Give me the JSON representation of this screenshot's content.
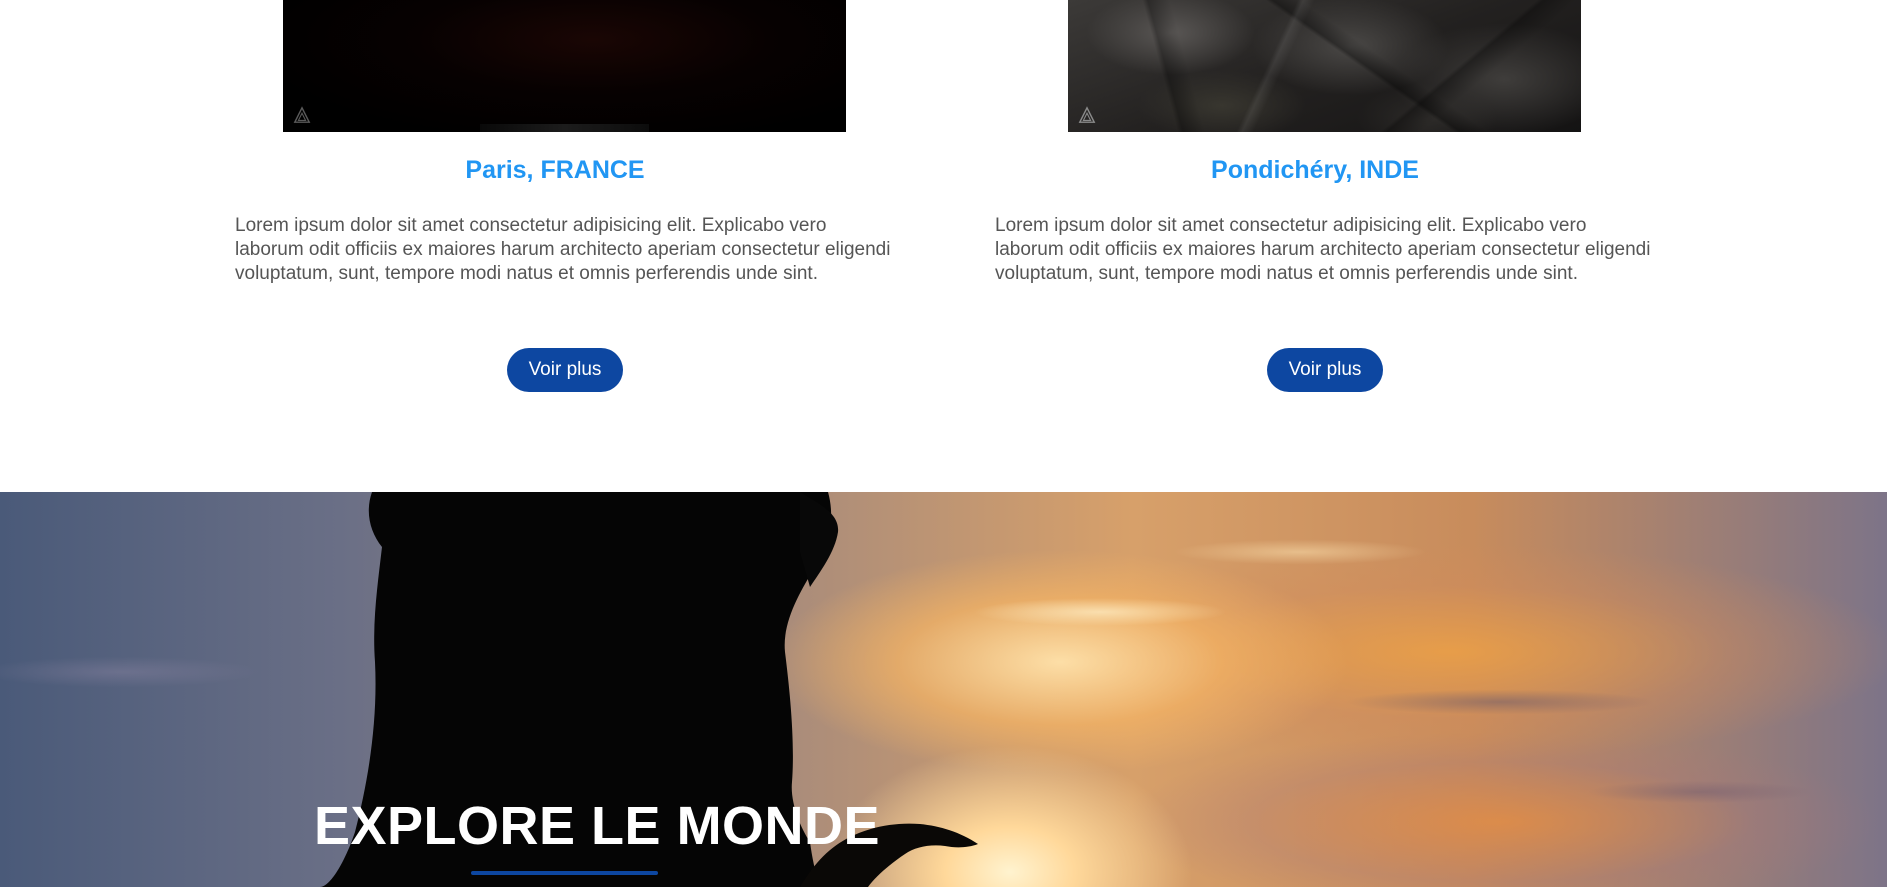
{
  "cards": [
    {
      "title": "Paris, FRANCE",
      "text": "Lorem ipsum dolor sit amet consectetur adipisicing elit. Explicabo vero laborum odit officiis ex maiores harum architecto aperiam consectetur eligendi voluptatum, sunt, tempore modi natus et omnis perferendis unde sint.",
      "button_label": "Voir plus"
    },
    {
      "title": "Pondichéry, INDE",
      "text": "Lorem ipsum dolor sit amet consectetur adipisicing elit. Explicabo vero laborum odit officiis ex maiores harum architecto aperiam consectetur eligendi voluptatum, sunt, tempore modi natus et omnis perferendis unde sint.",
      "button_label": "Voir plus"
    }
  ],
  "hero": {
    "title": "EXPLORE LE MONDE"
  },
  "colors": {
    "title_blue": "#2196f3",
    "button_blue": "#0d47a1",
    "body_text": "#555555"
  }
}
